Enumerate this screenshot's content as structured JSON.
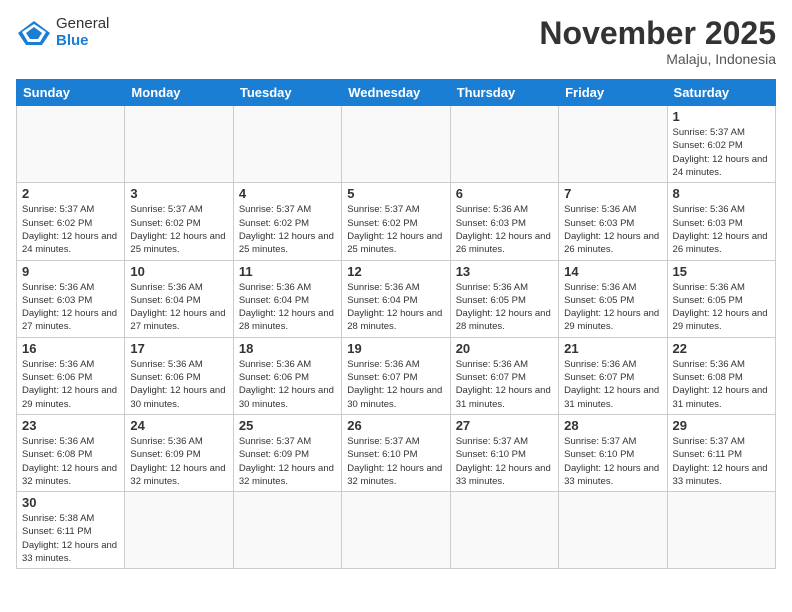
{
  "logo": {
    "text_general": "General",
    "text_blue": "Blue"
  },
  "header": {
    "month": "November 2025",
    "location": "Malaju, Indonesia"
  },
  "weekdays": [
    "Sunday",
    "Monday",
    "Tuesday",
    "Wednesday",
    "Thursday",
    "Friday",
    "Saturday"
  ],
  "weeks": [
    [
      {
        "day": "",
        "info": ""
      },
      {
        "day": "",
        "info": ""
      },
      {
        "day": "",
        "info": ""
      },
      {
        "day": "",
        "info": ""
      },
      {
        "day": "",
        "info": ""
      },
      {
        "day": "",
        "info": ""
      },
      {
        "day": "1",
        "info": "Sunrise: 5:37 AM\nSunset: 6:02 PM\nDaylight: 12 hours\nand 24 minutes."
      }
    ],
    [
      {
        "day": "2",
        "info": "Sunrise: 5:37 AM\nSunset: 6:02 PM\nDaylight: 12 hours\nand 24 minutes."
      },
      {
        "day": "3",
        "info": "Sunrise: 5:37 AM\nSunset: 6:02 PM\nDaylight: 12 hours\nand 25 minutes."
      },
      {
        "day": "4",
        "info": "Sunrise: 5:37 AM\nSunset: 6:02 PM\nDaylight: 12 hours\nand 25 minutes."
      },
      {
        "day": "5",
        "info": "Sunrise: 5:37 AM\nSunset: 6:02 PM\nDaylight: 12 hours\nand 25 minutes."
      },
      {
        "day": "6",
        "info": "Sunrise: 5:36 AM\nSunset: 6:03 PM\nDaylight: 12 hours\nand 26 minutes."
      },
      {
        "day": "7",
        "info": "Sunrise: 5:36 AM\nSunset: 6:03 PM\nDaylight: 12 hours\nand 26 minutes."
      },
      {
        "day": "8",
        "info": "Sunrise: 5:36 AM\nSunset: 6:03 PM\nDaylight: 12 hours\nand 26 minutes."
      }
    ],
    [
      {
        "day": "9",
        "info": "Sunrise: 5:36 AM\nSunset: 6:03 PM\nDaylight: 12 hours\nand 27 minutes."
      },
      {
        "day": "10",
        "info": "Sunrise: 5:36 AM\nSunset: 6:04 PM\nDaylight: 12 hours\nand 27 minutes."
      },
      {
        "day": "11",
        "info": "Sunrise: 5:36 AM\nSunset: 6:04 PM\nDaylight: 12 hours\nand 28 minutes."
      },
      {
        "day": "12",
        "info": "Sunrise: 5:36 AM\nSunset: 6:04 PM\nDaylight: 12 hours\nand 28 minutes."
      },
      {
        "day": "13",
        "info": "Sunrise: 5:36 AM\nSunset: 6:05 PM\nDaylight: 12 hours\nand 28 minutes."
      },
      {
        "day": "14",
        "info": "Sunrise: 5:36 AM\nSunset: 6:05 PM\nDaylight: 12 hours\nand 29 minutes."
      },
      {
        "day": "15",
        "info": "Sunrise: 5:36 AM\nSunset: 6:05 PM\nDaylight: 12 hours\nand 29 minutes."
      }
    ],
    [
      {
        "day": "16",
        "info": "Sunrise: 5:36 AM\nSunset: 6:06 PM\nDaylight: 12 hours\nand 29 minutes."
      },
      {
        "day": "17",
        "info": "Sunrise: 5:36 AM\nSunset: 6:06 PM\nDaylight: 12 hours\nand 30 minutes."
      },
      {
        "day": "18",
        "info": "Sunrise: 5:36 AM\nSunset: 6:06 PM\nDaylight: 12 hours\nand 30 minutes."
      },
      {
        "day": "19",
        "info": "Sunrise: 5:36 AM\nSunset: 6:07 PM\nDaylight: 12 hours\nand 30 minutes."
      },
      {
        "day": "20",
        "info": "Sunrise: 5:36 AM\nSunset: 6:07 PM\nDaylight: 12 hours\nand 31 minutes."
      },
      {
        "day": "21",
        "info": "Sunrise: 5:36 AM\nSunset: 6:07 PM\nDaylight: 12 hours\nand 31 minutes."
      },
      {
        "day": "22",
        "info": "Sunrise: 5:36 AM\nSunset: 6:08 PM\nDaylight: 12 hours\nand 31 minutes."
      }
    ],
    [
      {
        "day": "23",
        "info": "Sunrise: 5:36 AM\nSunset: 6:08 PM\nDaylight: 12 hours\nand 32 minutes."
      },
      {
        "day": "24",
        "info": "Sunrise: 5:36 AM\nSunset: 6:09 PM\nDaylight: 12 hours\nand 32 minutes."
      },
      {
        "day": "25",
        "info": "Sunrise: 5:37 AM\nSunset: 6:09 PM\nDaylight: 12 hours\nand 32 minutes."
      },
      {
        "day": "26",
        "info": "Sunrise: 5:37 AM\nSunset: 6:10 PM\nDaylight: 12 hours\nand 32 minutes."
      },
      {
        "day": "27",
        "info": "Sunrise: 5:37 AM\nSunset: 6:10 PM\nDaylight: 12 hours\nand 33 minutes."
      },
      {
        "day": "28",
        "info": "Sunrise: 5:37 AM\nSunset: 6:10 PM\nDaylight: 12 hours\nand 33 minutes."
      },
      {
        "day": "29",
        "info": "Sunrise: 5:37 AM\nSunset: 6:11 PM\nDaylight: 12 hours\nand 33 minutes."
      }
    ],
    [
      {
        "day": "30",
        "info": "Sunrise: 5:38 AM\nSunset: 6:11 PM\nDaylight: 12 hours\nand 33 minutes."
      },
      {
        "day": "",
        "info": ""
      },
      {
        "day": "",
        "info": ""
      },
      {
        "day": "",
        "info": ""
      },
      {
        "day": "",
        "info": ""
      },
      {
        "day": "",
        "info": ""
      },
      {
        "day": "",
        "info": ""
      }
    ]
  ]
}
